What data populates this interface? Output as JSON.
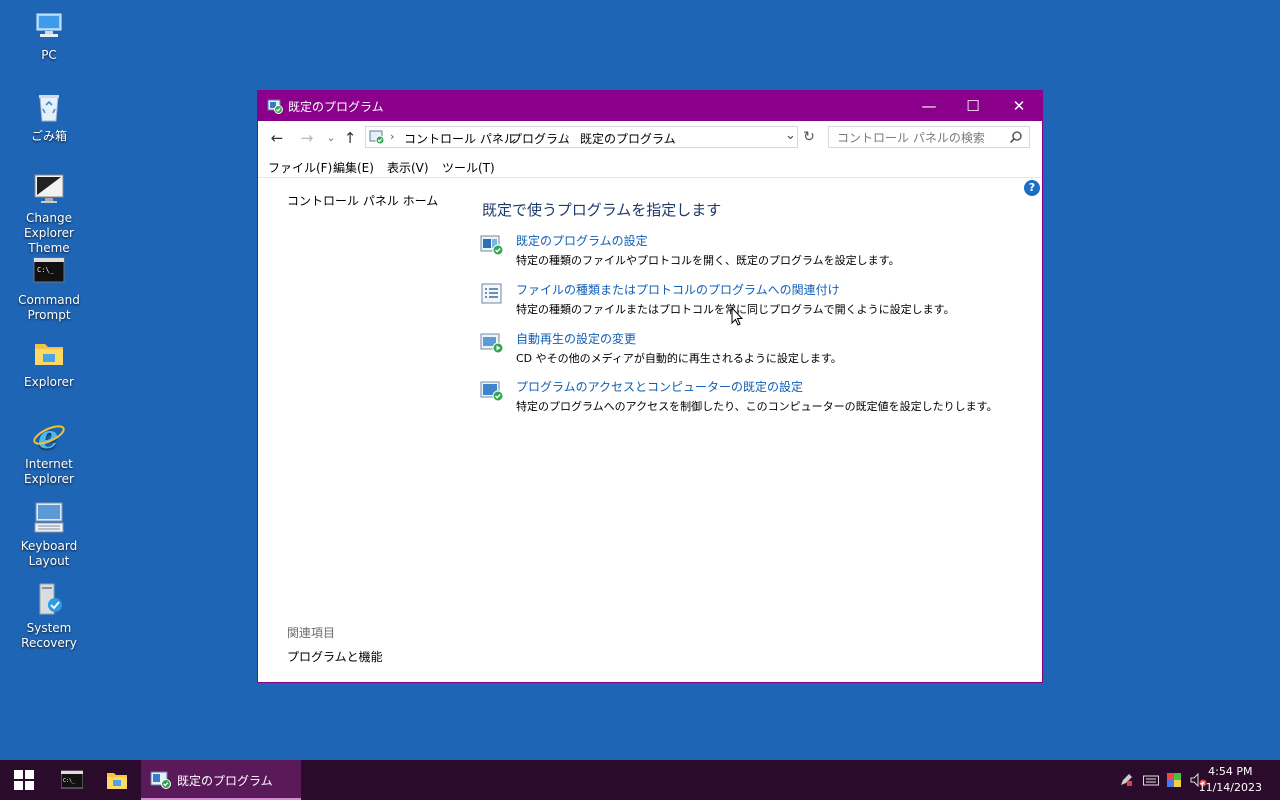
{
  "desktop": {
    "icons": [
      {
        "label": "PC",
        "icon": "pc-icon"
      },
      {
        "label": "ごみ箱",
        "icon": "recycle-bin-icon"
      },
      {
        "label": "Change Explorer Theme",
        "icon": "monitor-icon"
      },
      {
        "label": "Command Prompt",
        "icon": "command-prompt-icon"
      },
      {
        "label": "Explorer",
        "icon": "folder-icon"
      },
      {
        "label": "Internet Explorer",
        "icon": "internet-explorer-icon"
      },
      {
        "label": "Keyboard Layout",
        "icon": "keyboard-icon"
      },
      {
        "label": "System Recovery",
        "icon": "system-recovery-icon"
      }
    ]
  },
  "window": {
    "title": "既定のプログラム",
    "controls": {
      "minimize": "—",
      "maximize": "☐",
      "close": "✕"
    },
    "nav": {
      "back": "←",
      "forward": "→",
      "recent": "⌄",
      "up": "↑",
      "refresh": "↻"
    },
    "breadcrumb": [
      "コントロール パネル",
      "プログラム",
      "既定のプログラム"
    ],
    "breadcrumb_separator": "›",
    "search": {
      "placeholder": "コントロール パネルの検索"
    },
    "menu": [
      "ファイル(F)",
      "編集(E)",
      "表示(V)",
      "ツール(T)"
    ],
    "left_pane": {
      "home_link": "コントロール パネル ホーム",
      "related_heading": "関連項目",
      "related_link": "プログラムと機能"
    },
    "help": "?",
    "main": {
      "title": "既定で使うプログラムを指定します",
      "options": [
        {
          "link": "既定のプログラムの設定",
          "desc": "特定の種類のファイルやプロトコルを開く、既定のプログラムを設定します。",
          "icon": "default-programs-icon"
        },
        {
          "link": "ファイルの種類またはプロトコルのプログラムへの関連付け",
          "desc": "特定の種類のファイルまたはプロトコルを常に同じプログラムで開くように設定します。",
          "icon": "file-association-icon"
        },
        {
          "link": "自動再生の設定の変更",
          "desc": "CD やその他のメディアが自動的に再生されるように設定します。",
          "icon": "autoplay-icon"
        },
        {
          "link": "プログラムのアクセスとコンピューターの既定の設定",
          "desc": "特定のプログラムへのアクセスを制御したり、このコンピューターの既定値を設定したりします。",
          "icon": "program-access-icon"
        }
      ]
    }
  },
  "taskbar": {
    "active_task": "既定のプログラム",
    "time": "4:54 PM",
    "date": "11/14/2023"
  },
  "colors": {
    "desktop": "#1f65b5",
    "titlebar": "#8b008b",
    "taskbar": "#2b0b2b",
    "link": "#0f5fb6"
  }
}
